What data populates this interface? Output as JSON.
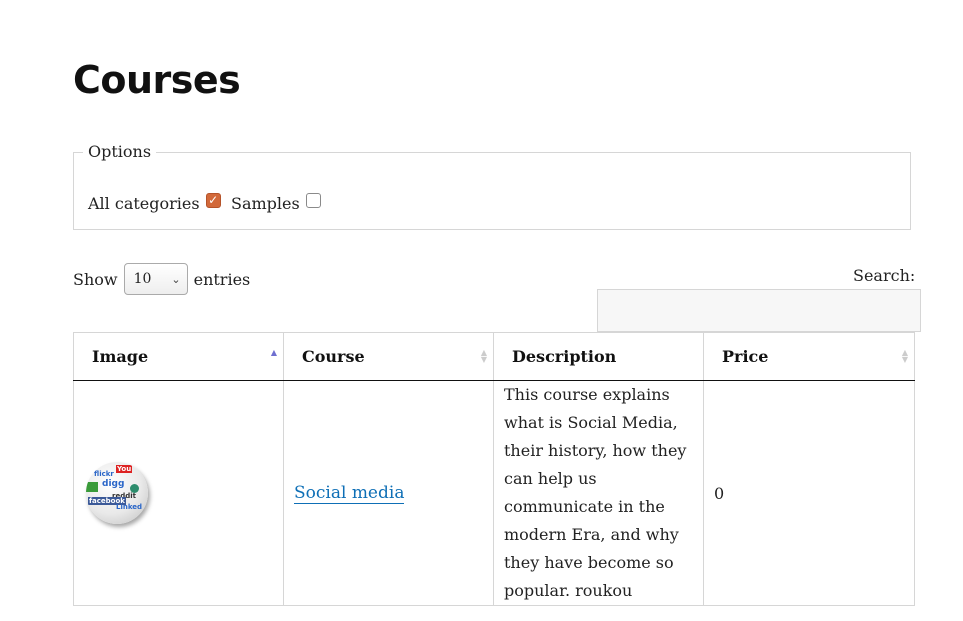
{
  "page": {
    "title": "Courses"
  },
  "options": {
    "legend": "Options",
    "all_categories": {
      "label": "All categories",
      "checked": true
    },
    "samples": {
      "label": "Samples",
      "checked": false
    }
  },
  "length": {
    "show_label": "Show",
    "value": "10",
    "entries_label": "entries"
  },
  "search": {
    "label": "Search:",
    "value": ""
  },
  "table": {
    "columns": [
      "Image",
      "Course",
      "Description",
      "Price"
    ],
    "sorted_column": "Image",
    "rows": [
      {
        "image_icon": "social-media-globe-icon",
        "course": "Social media",
        "description": "This course explains what is Social Media, their history, how they can help us communicate in the modern Era, and why they have become so popular. roukou",
        "price": "0"
      }
    ]
  },
  "colors": {
    "link": "#0e6fb6",
    "checkbox_checked": "#d2693a",
    "sort_active": "#6f6fd0"
  }
}
